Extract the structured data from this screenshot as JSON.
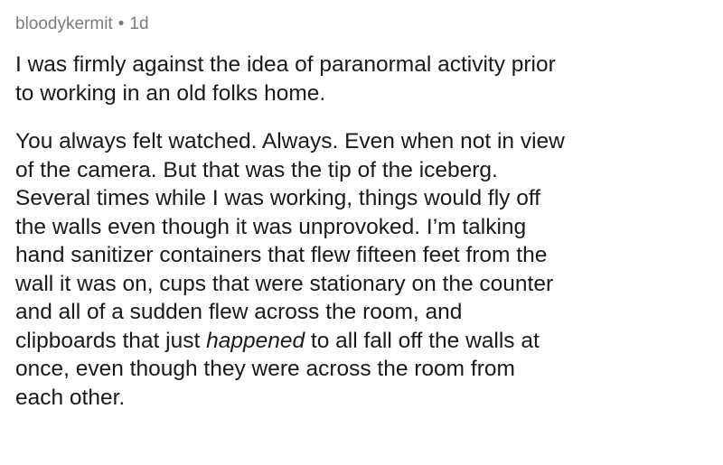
{
  "comment": {
    "author": "bloodykermit",
    "separator": "•",
    "age": "1d",
    "paragraph1": [
      "I was firmly against the idea of paranormal activity prior",
      "to working in an old folks home."
    ],
    "paragraph2": [
      {
        "text": "You always felt watched. Always. Even when not in view"
      },
      {
        "text": "of the camera. But that was the tip of the iceberg."
      },
      {
        "text": "Several times while I was working, things would fly off"
      },
      {
        "text": "the walls even though it was unprovoked. I’m talking"
      },
      {
        "text": "hand sanitizer containers that flew fifteen feet from the"
      },
      {
        "text": "wall it was on, cups that were stationary on the counter"
      },
      {
        "text": "and all of a sudden flew across the room, and"
      },
      {
        "pre": "clipboards that just ",
        "em": "happened",
        "post": " to all fall off the walls at"
      },
      {
        "text": "once, even though they were across the room from"
      },
      {
        "text": "each other."
      }
    ]
  }
}
